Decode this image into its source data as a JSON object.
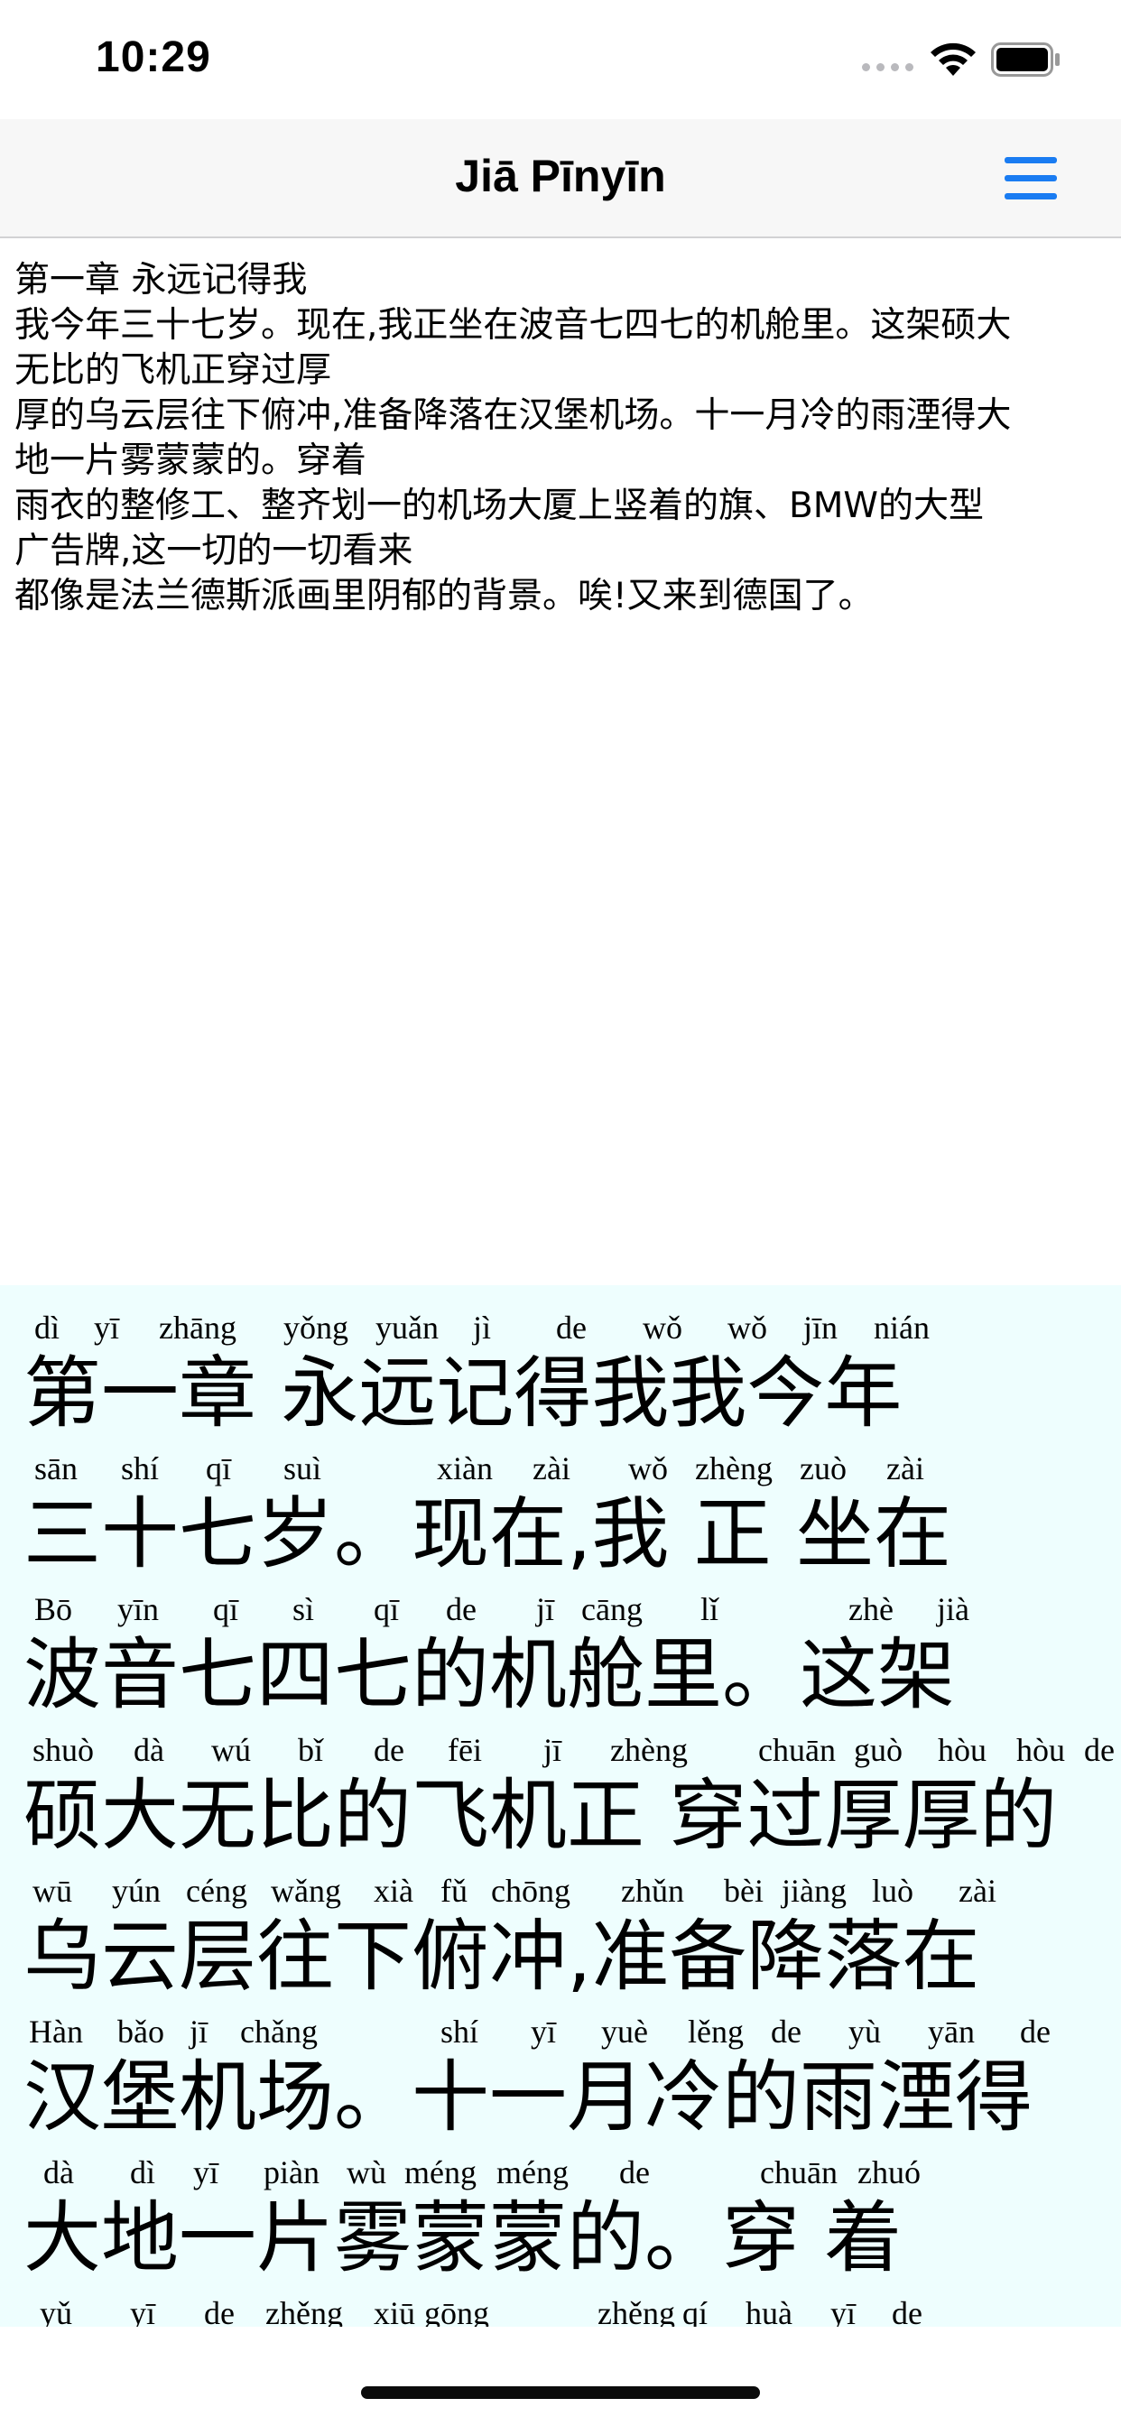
{
  "status_bar": {
    "time": "10:29"
  },
  "nav": {
    "title": "Jiā Pīnyīn"
  },
  "source_text": [
    "第一章 永远记得我",
    "我今年三十七岁。现在,我正坐在波音七四七的机舱里。这架硕大",
    "无比的飞机正穿过厚",
    "厚的乌云层往下俯冲,准备降落在汉堡机场。十一月冷的雨湮得大",
    "地一片雾蒙蒙的。穿着",
    "雨衣的整修工、整齐划一的机场大厦上竖着的旗、BMW的大型",
    "广告牌,这一切的一切看来",
    "都像是法兰德斯派画里阴郁的背景。唉!又来到德国了。"
  ],
  "pinyin_lines": [
    {
      "hanzi": "第一章 永远记得我我今年",
      "pinyin": [
        "dì",
        "yī",
        "zhāng",
        "yǒng",
        "yuǎn",
        "jì",
        "de",
        "wǒ",
        "wǒ",
        "jīn",
        "nián"
      ]
    },
    {
      "hanzi": "三十七岁。现在,我 正 坐在",
      "pinyin": [
        "sān",
        "shí",
        "qī",
        "suì",
        "xiàn",
        "zài",
        "wǒ",
        "zhèng",
        "zuò",
        "zài"
      ]
    },
    {
      "hanzi": "波音七四七的机舱里。这架",
      "pinyin": [
        "Bō",
        "yīn",
        "qī",
        "sì",
        "qī",
        "de",
        "jī",
        "cāng",
        "lǐ",
        "zhè",
        "jià"
      ]
    },
    {
      "hanzi": "硕大无比的飞机正 穿过厚厚的",
      "pinyin": [
        "shuò",
        "dà",
        "wú",
        "bǐ",
        "de",
        "fēi",
        "jī",
        "zhèng",
        "chuān",
        "guò",
        "hòu",
        "hòu",
        "de"
      ]
    },
    {
      "hanzi": "乌云层往下俯冲,准备降落在",
      "pinyin": [
        "wū",
        "yún",
        "céng",
        "wǎng",
        "xià",
        "fǔ",
        "chōng",
        "zhǔn",
        "bèi",
        "jiàng",
        "luò",
        "zài"
      ]
    },
    {
      "hanzi": "汉堡机场。十一月冷的雨湮得",
      "pinyin": [
        "Hàn",
        "bǎo",
        "jī",
        "chǎng",
        "shí",
        "yī",
        "yuè",
        "lěng",
        "de",
        "yù",
        "yān",
        "de"
      ]
    },
    {
      "hanzi": "大地一片雾蒙蒙的。穿 着",
      "pinyin": [
        "dà",
        "dì",
        "yī",
        "piàn",
        "wù",
        "méng",
        "méng",
        "de",
        "chuān",
        "zhuó"
      ]
    },
    {
      "hanzi": "",
      "pinyin": [
        "yǔ",
        "yī",
        "de",
        "zhěng",
        "xiū",
        "gōng",
        "zhěng",
        "qí",
        "huà",
        "yī",
        "de"
      ]
    }
  ]
}
